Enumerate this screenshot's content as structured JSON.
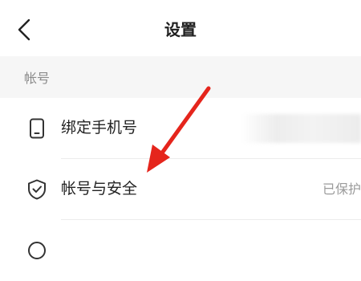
{
  "header": {
    "title": "设置"
  },
  "section": {
    "label": "帐号"
  },
  "rows": [
    {
      "label": "绑定手机号",
      "value": ""
    },
    {
      "label": "帐号与安全",
      "value": "已保护"
    }
  ],
  "colors": {
    "arrow": "#e5251c",
    "section_bg": "#f6f6f6",
    "muted_text": "#9b9b9b"
  }
}
